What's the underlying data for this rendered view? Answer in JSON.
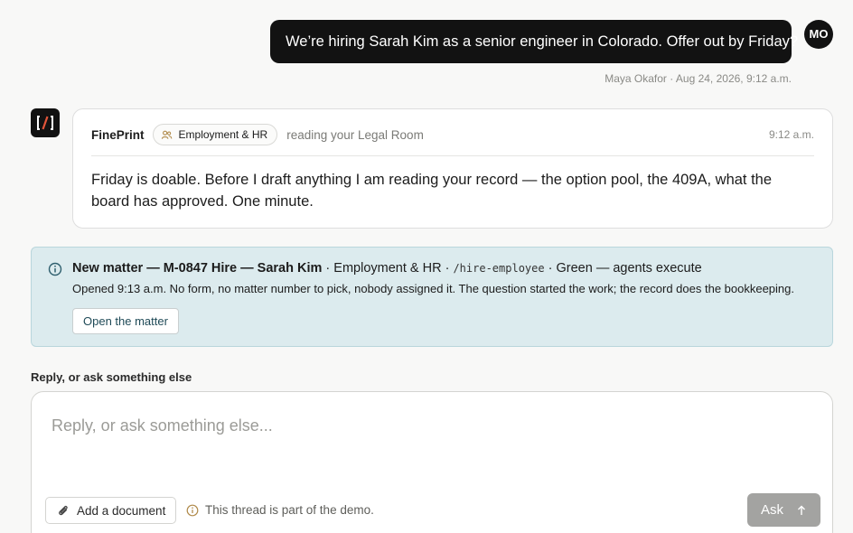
{
  "user_message": {
    "text": "We’re hiring Sarah Kim as a senior engineer in Colorado. Offer out by Friday?",
    "avatar_initials": "MO",
    "meta": "Maya Okafor · Aug 24, 2026, 9:12 a.m."
  },
  "assistant_message": {
    "logo_text": "[/]",
    "name": "FinePrint",
    "tag": {
      "icon": "people-icon",
      "label": "Employment & HR"
    },
    "status": "reading your Legal Room",
    "time": "9:12 a.m.",
    "text": "Friday is doable. Before I draft anything I am reading your record — the option pool, the 409A, what the board has approved. One minute."
  },
  "matter_notice": {
    "icon": "info-icon",
    "title": "New matter — M-0847 Hire — Sarah Kim",
    "sep1": " · ",
    "area": "Employment & HR",
    "sep2": " · ",
    "command": "/hire-employee",
    "sep3": " · ",
    "status": "Green — agents execute",
    "detail": "Opened 9:13 a.m. No form, no matter number to pick, nobody assigned it. The question started the work; the record does the bookkeeping.",
    "button": "Open the matter"
  },
  "reply": {
    "label": "Reply, or ask something else",
    "placeholder": "Reply, or ask something else...",
    "add_document": "Add a document",
    "demo_note": "This thread is part of the demo.",
    "ask_button": "Ask"
  },
  "colors": {
    "background": "#f8f8f7",
    "dark": "#121212",
    "notice_bg": "#dcebee",
    "notice_border": "#b9d6dc",
    "ask_button": "#a3a3a1",
    "tag_icon": "#b08a4a"
  }
}
